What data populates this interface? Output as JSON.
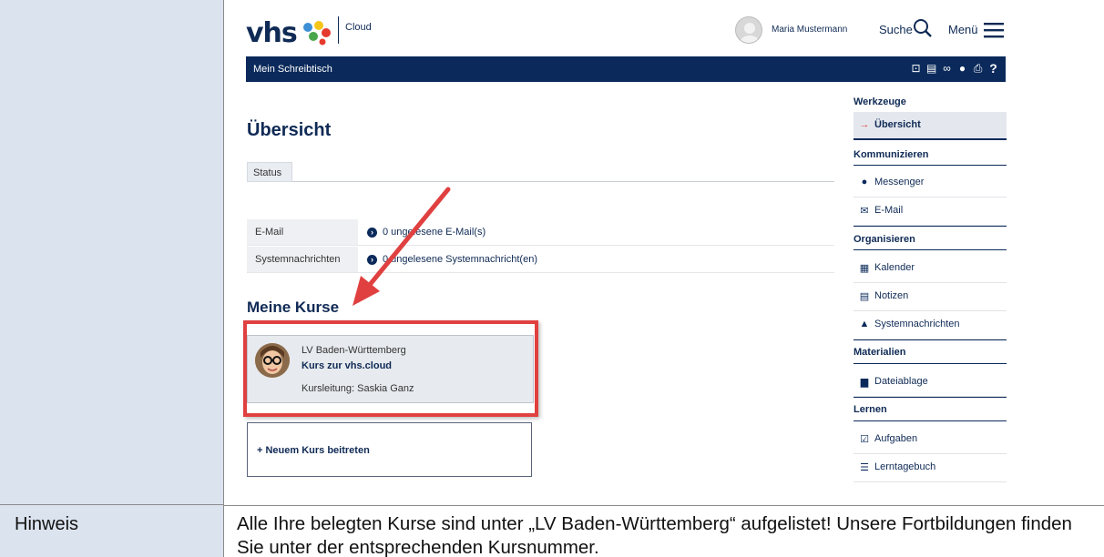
{
  "doc": {
    "hint_label": "Hinweis",
    "hint_text": "Alle Ihre belegten Kurse sind unter „LV Baden-Württemberg“ aufgelistet! Unsere Fortbildungen finden Sie unter der entsprechenden Kursnummer."
  },
  "header": {
    "logo_text": "vhs",
    "logo_sub": "Cloud",
    "user_name": "Maria Mustermann",
    "search_label": "Suche",
    "menu_label": "Menü"
  },
  "navbar": {
    "title": "Mein Schreibtisch",
    "icons": [
      "board-icon",
      "notes-icon",
      "link-icon",
      "location-icon",
      "print-icon",
      "help-icon"
    ]
  },
  "main": {
    "title": "Übersicht",
    "status_tab": "Status",
    "rows": [
      {
        "key": "E-Mail",
        "value": "0 ungelesene E-Mail(s)"
      },
      {
        "key": "Systemnachrichten",
        "value": "0 ungelesene Systemnachricht(en)"
      }
    ],
    "courses_title": "Meine Kurse",
    "course": {
      "org": "LV Baden-Württemberg",
      "name": "Kurs zur vhs.cloud",
      "lead": "Kursleitung: Saskia Ganz"
    },
    "join_label": "+ Neuem Kurs beitreten"
  },
  "sidebar": {
    "sections": [
      {
        "title": "Werkzeuge",
        "items": [
          {
            "label": "Übersicht",
            "icon": "→",
            "active": true
          }
        ]
      },
      {
        "title": "Kommunizieren",
        "items": [
          {
            "label": "Messenger",
            "icon": "●"
          },
          {
            "label": "E-Mail",
            "icon": "✉"
          }
        ]
      },
      {
        "title": "Organisieren",
        "items": [
          {
            "label": "Kalender",
            "icon": "▦"
          },
          {
            "label": "Notizen",
            "icon": "▤"
          },
          {
            "label": "Systemnachrichten",
            "icon": "▲"
          }
        ]
      },
      {
        "title": "Materialien",
        "items": [
          {
            "label": "Dateiablage",
            "icon": "▆"
          }
        ]
      },
      {
        "title": "Lernen",
        "items": [
          {
            "label": "Aufgaben",
            "icon": "☑"
          },
          {
            "label": "Lerntagebuch",
            "icon": "☰"
          }
        ]
      }
    ]
  },
  "colors": {
    "brand": "#0b2a5b",
    "highlight": "#e04040",
    "doc_cell": "#dbe3ef"
  }
}
